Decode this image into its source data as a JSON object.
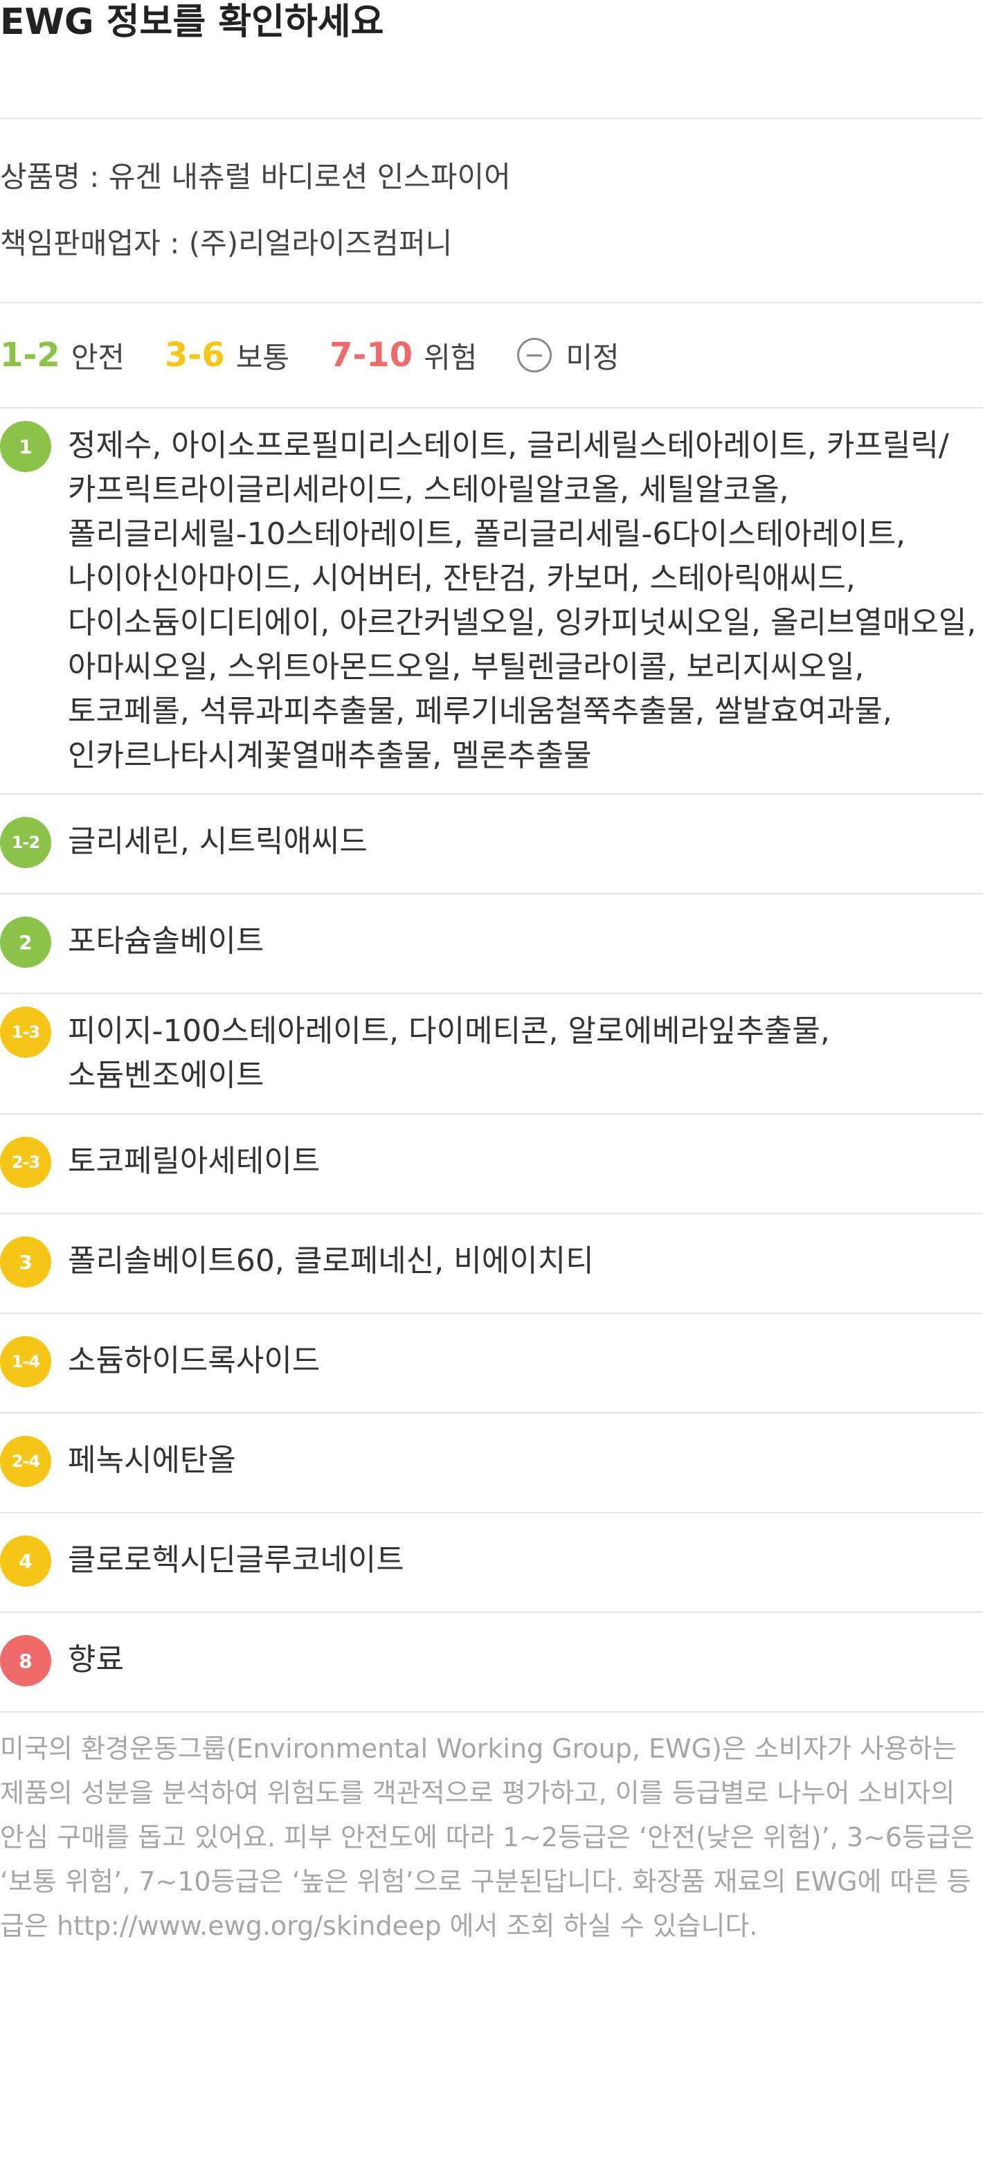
{
  "title": "EWG 정보를 확인하세요",
  "info": {
    "product": "상품명 : 유겐 내츄럴 바디로션 인스파이어",
    "seller": "책임판매업자 : (주)리얼라이즈컴퍼니"
  },
  "legend": [
    {
      "grade": "1-2",
      "label": "안전",
      "color": "#8bc34a"
    },
    {
      "grade": "3-6",
      "label": "보통",
      "color": "#f5c518"
    },
    {
      "grade": "7-10",
      "label": "위험",
      "color": "#ef6b6b"
    },
    {
      "grade": "",
      "label": "미정",
      "color": "#8a8a8a",
      "icon": "minus-circle-icon"
    }
  ],
  "ingredients": [
    {
      "grade": "1",
      "color": "#8bc34a",
      "text": "정제수, 아이소프로필미리스테이트, 글리세릴스테아레이트, 카프릴릭/카프릭트라이글리세라이드, 스테아릴알코올, 세틸알코올, 폴리글리세릴-10스테아레이트, 폴리글리세릴-6다이스테아레이트, 나이아신아마이드, 시어버터, 잔탄검, 카보머, 스테아릭애씨드, 다이소듐이디티에이, 아르간커넬오일, 잉카피넛씨오일, 올리브열매오일, 아마씨오일, 스위트아몬드오일, 부틸렌글라이콜, 보리지씨오일, 토코페롤, 석류과피추출물, 페루기네움철쭉추출물, 쌀발효여과물, 인카르나타시계꽃열매추출물, 멜론추출물"
    },
    {
      "grade": "1-2",
      "color": "#8bc34a",
      "text": "글리세린, 시트릭애씨드"
    },
    {
      "grade": "2",
      "color": "#8bc34a",
      "text": "포타슘솔베이트"
    },
    {
      "grade": "1-3",
      "color": "#f5c518",
      "text": "피이지-100스테아레이트, 다이메티콘, 알로에베라잎추출물, 소듐벤조에이트"
    },
    {
      "grade": "2-3",
      "color": "#f5c518",
      "text": "토코페릴아세테이트"
    },
    {
      "grade": "3",
      "color": "#f5c518",
      "text": "폴리솔베이트60, 클로페네신, 비에이치티"
    },
    {
      "grade": "1-4",
      "color": "#f5c518",
      "text": "소듐하이드록사이드"
    },
    {
      "grade": "2-4",
      "color": "#f5c518",
      "text": "페녹시에탄올"
    },
    {
      "grade": "4",
      "color": "#f5c518",
      "text": "클로로헥시딘글루코네이트"
    },
    {
      "grade": "8",
      "color": "#ef6b6b",
      "text": "향료"
    }
  ],
  "footer": "미국의 환경운동그룹(Environmental Working Group, EWG)은 소비자가 사용하는 제품의 성분을 분석하여 위험도를 객관적으로 평가하고, 이를 등급별로 나누어 소비자의 안심 구매를 돕고 있어요. 피부 안전도에 따라 1~2등급은 ‘안전(낮은 위험)’, 3~6등급은 ‘보통 위험’, 7~10등급은 ‘높은 위험’으로 구분된답니다. 화장품 재료의 EWG에 따른 등급은 http://www.ewg.org/skindeep 에서 조회 하실 수 있습니다."
}
